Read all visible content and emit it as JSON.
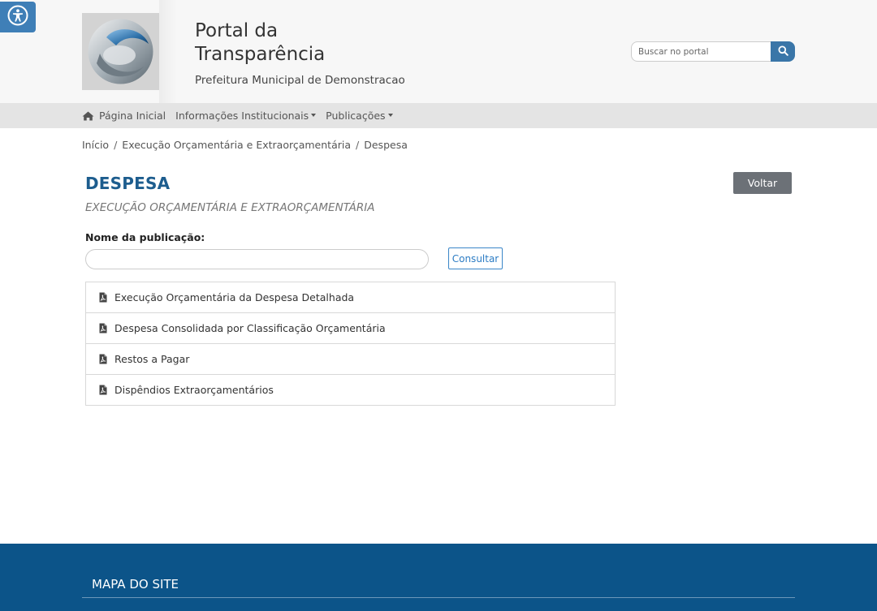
{
  "accessibility": {
    "icon": "accessibility-icon"
  },
  "header": {
    "logo": "portal-logo",
    "title": "Portal da Transparência",
    "subtitle": "Prefeitura Municipal de Demonstracao",
    "search": {
      "placeholder": "Buscar no portal",
      "value": "",
      "icon": "search-icon"
    }
  },
  "nav": {
    "items": [
      {
        "label": "Página Inicial",
        "icon": "home-icon"
      },
      {
        "label": "Informações Institucionais",
        "dropdown": true
      },
      {
        "label": "Publicações",
        "dropdown": true
      }
    ]
  },
  "breadcrumb": {
    "items": [
      "Início",
      "Execução Orçamentária e Extraorçamentária",
      "Despesa"
    ],
    "separator": "/"
  },
  "page": {
    "title": "DESPESA",
    "subtitle": "EXECUÇÃO ORÇAMENTÁRIA E EXTRAORÇAMENTÁRIA",
    "back_label": "Voltar",
    "field_label": "Nome da publicação:",
    "field_value": "",
    "consult_label": "Consultar"
  },
  "publications": [
    {
      "label": "Execução Orçamentária da Despesa Detalhada",
      "icon": "pdf-icon"
    },
    {
      "label": "Despesa Consolidada por Classificação Orçamentária",
      "icon": "pdf-icon"
    },
    {
      "label": "Restos a Pagar",
      "icon": "pdf-icon"
    },
    {
      "label": "Dispêndios Extraorçamentários",
      "icon": "pdf-icon"
    }
  ],
  "footer": {
    "title": "MAPA DO SITE"
  },
  "colors": {
    "brand_blue": "#1d5d8e",
    "footer_bg": "#0c5489",
    "accent_button": "#3a76a8",
    "back_button": "#6c7177"
  }
}
